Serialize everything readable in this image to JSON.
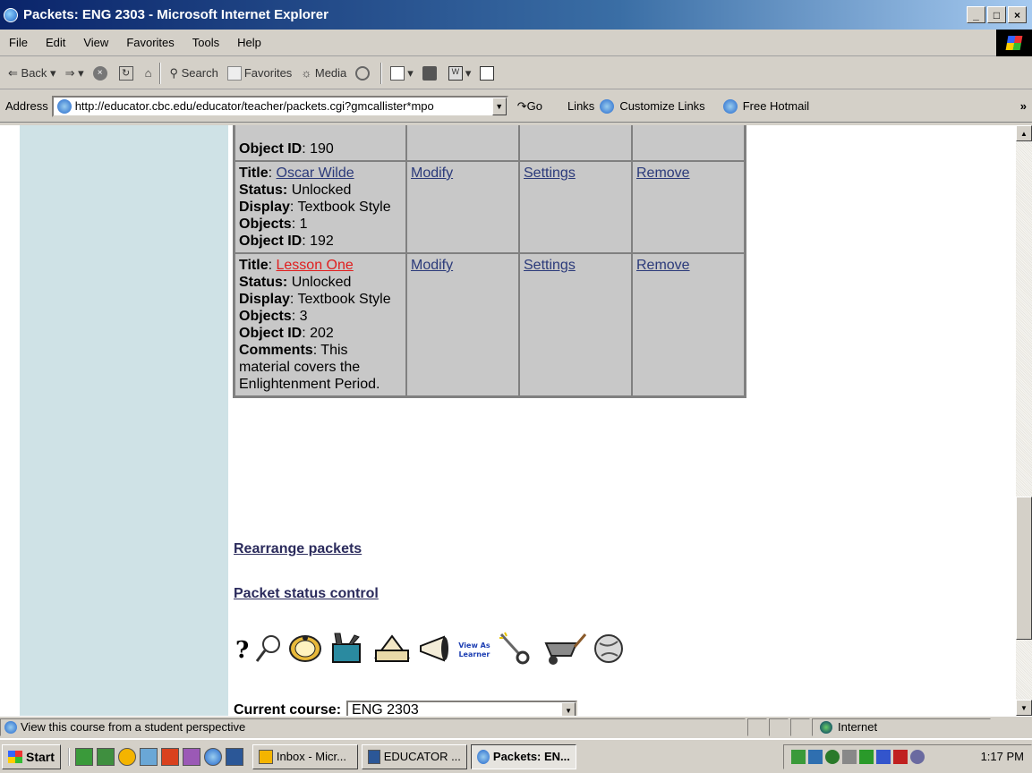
{
  "window": {
    "title": "Packets: ENG 2303 - Microsoft Internet Explorer",
    "min": "_",
    "max": "□",
    "close": "×"
  },
  "menu": [
    "File",
    "Edit",
    "View",
    "Favorites",
    "Tools",
    "Help"
  ],
  "toolbar": {
    "back": "Back",
    "search": "Search",
    "favorites": "Favorites",
    "media": "Media"
  },
  "address": {
    "label": "Address",
    "url": "http://educator.cbc.edu/educator/teacher/packets.cgi?gmcallister*mpo",
    "go": "Go",
    "links_label": "Links",
    "link1": "Customize Links",
    "link2": "Free Hotmail",
    "more": "»"
  },
  "packets": {
    "labels": {
      "title": "Title",
      "status": "Status:",
      "display": "Display",
      "objects": "Objects",
      "object_id": "Object ID",
      "comments": "Comments"
    },
    "actions": {
      "modify": "Modify",
      "settings": "Settings",
      "remove": "Remove"
    },
    "partial_row": {
      "object_id": "190"
    },
    "rows": [
      {
        "title": "Oscar Wilde",
        "status": "Unlocked",
        "display": "Textbook Style",
        "objects": "1",
        "object_id": "192"
      },
      {
        "title": "Lesson One",
        "status": "Unlocked",
        "display": "Textbook Style",
        "objects": "3",
        "object_id": "202",
        "comments": "This material covers the Enlightenment Period."
      }
    ]
  },
  "links": {
    "rearrange": "Rearrange packets",
    "status_control": "Packet status control"
  },
  "view_as_learner": [
    "View As",
    "Learner"
  ],
  "current_course": {
    "label": "Current course:",
    "value": "ENG 2303"
  },
  "statusbar": {
    "message": "View this course from a student perspective",
    "zone": "Internet"
  },
  "taskbar": {
    "start": "Start",
    "tasks": [
      "Inbox - Micr...",
      "EDUCATOR ...",
      "Packets: EN..."
    ],
    "clock": "1:17 PM"
  }
}
